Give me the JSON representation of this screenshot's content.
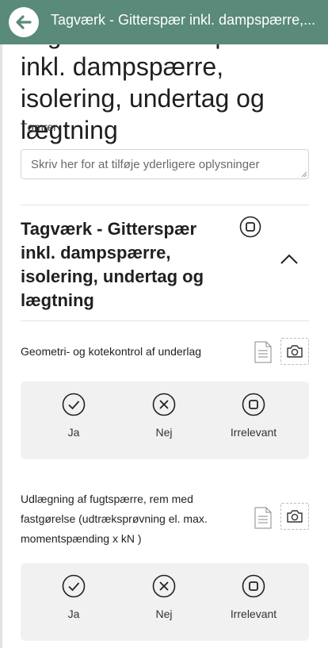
{
  "header": {
    "title": "Tagværk - Gitterspær inkl. dampspærre,...",
    "back_icon": "arrow-left-icon"
  },
  "page": {
    "title": "Tagværk - Gitterspær inkl. dampspærre, isolering, undertag og lægtning",
    "trade": "Tømrer",
    "info_placeholder": "Skriv her for at tilføje yderligere oplysninger"
  },
  "section": {
    "title": "Tagværk - Gitterspær inkl. dampspærre, isolering, undertag og lægtning",
    "status_icon": "stop-circle-icon",
    "toggle_icon": "chevron-up-icon"
  },
  "checkpoints": [
    {
      "label": "Geometri- og kotekontrol af underlag",
      "options": [
        "Ja",
        "Nej",
        "Irrelevant"
      ]
    },
    {
      "label": "Udlægning af fugtspærre, rem med fastgørelse (udtræksprøvning el. max. momentspænding x kN )",
      "options": [
        "Ja",
        "Nej",
        "Irrelevant"
      ]
    }
  ],
  "colors": {
    "header_bg": "#5a8a79",
    "answer_bg": "#f1f1f1"
  }
}
